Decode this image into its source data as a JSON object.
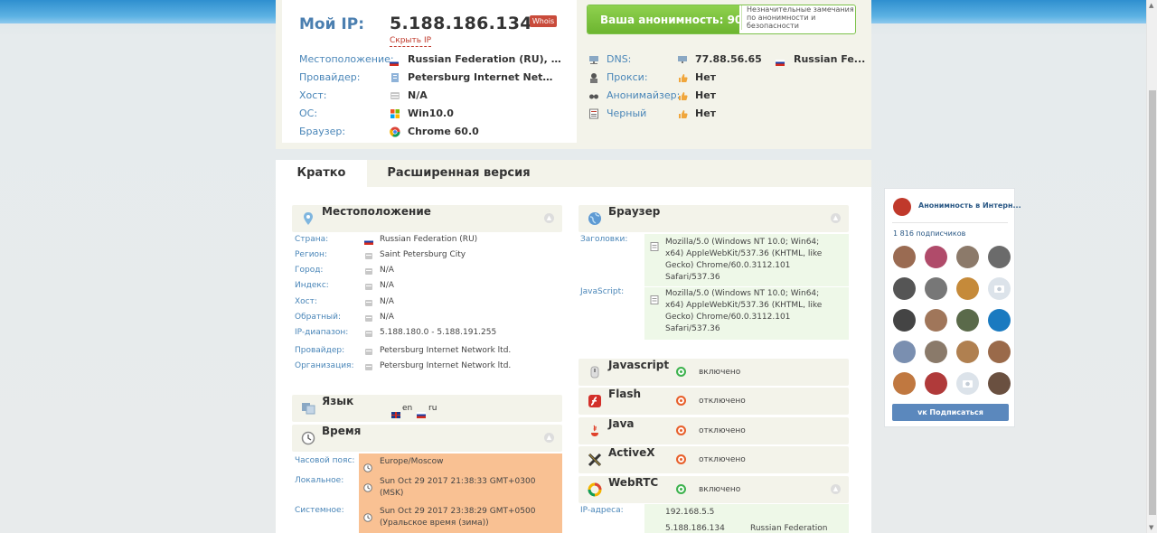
{
  "summary": {
    "ip_label": "Мой IP:",
    "ip_value": "5.188.186.134",
    "whois_label": "Whois",
    "hide_ip_label": "Скрыть IP",
    "rows": [
      {
        "label": "Местоположение:",
        "value": "Russian Federation (RU), N...",
        "icon": "flag-ru-icon"
      },
      {
        "label": "Провайдер:",
        "value": "Petersburg Internet Netwo...",
        "icon": "provider-icon"
      },
      {
        "label": "Хост:",
        "value": "N/A",
        "icon": "host-icon"
      },
      {
        "label": "ОС:",
        "value": "Win10.0",
        "icon": "windows-icon"
      },
      {
        "label": "Браузер:",
        "value": "Chrome 60.0",
        "icon": "chrome-icon"
      }
    ],
    "anonymity": {
      "label": "Ваша анонимность: 90%",
      "percent": 90,
      "note": "Незначительные замечания по анонимности и безопасности"
    },
    "right_rows": [
      {
        "label": "DNS:",
        "value": "77.88.56.65",
        "extra": "Russian Fe..."
      },
      {
        "label": "Прокси:",
        "value": "Нет"
      },
      {
        "label": "Анонимайзер:",
        "value": "Нет"
      },
      {
        "label": "Черный",
        "value": "Нет"
      }
    ]
  },
  "tabs": [
    "Кратко",
    "Расширенная версия"
  ],
  "location": {
    "title": "Местоположение",
    "rows": [
      {
        "label": "Страна:",
        "value": "Russian Federation (RU)"
      },
      {
        "label": "Регион:",
        "value": "Saint Petersburg City"
      },
      {
        "label": "Город:",
        "value": "N/A"
      },
      {
        "label": "Индекс:",
        "value": "N/A"
      },
      {
        "label": "Хост:",
        "value": "N/A"
      },
      {
        "label": "Обратный:",
        "value": "N/A"
      },
      {
        "label": "IP-диапазон:",
        "value": "5.188.180.0 - 5.188.191.255"
      },
      {
        "label": "Провайдер:",
        "value": "Petersburg Internet Network ltd."
      },
      {
        "label": "Организация:",
        "value": "Petersburg Internet Network ltd."
      }
    ]
  },
  "language": {
    "title": "Язык",
    "en": "en",
    "ru": "ru"
  },
  "time": {
    "title": "Время",
    "rows": [
      {
        "label": "Часовой пояс:",
        "lines": [
          "Europe/Moscow"
        ]
      },
      {
        "label": "Локальное:",
        "lines": [
          "Sun Oct 29 2017 21:38:33 GMT+0300",
          "(MSK)"
        ]
      },
      {
        "label": "Системное:",
        "lines": [
          "Sun Oct 29 2017 23:38:29 GMT+0500",
          "(Уральское время (зима))"
        ]
      }
    ]
  },
  "browser": {
    "title": "Браузер",
    "headers_label": "Заголовки:",
    "headers_lines": [
      "Mozilla/5.0 (Windows NT 10.0; Win64;",
      "x64) AppleWebKit/537.36 (KHTML, like",
      "Gecko) Chrome/60.0.3112.101",
      "Safari/537.36"
    ],
    "js_label": "JavaScript:",
    "js_lines": [
      "Mozilla/5.0 (Windows NT 10.0; Win64;",
      "x64) AppleWebKit/537.36 (KHTML, like",
      "Gecko) Chrome/60.0.3112.101",
      "Safari/537.36"
    ]
  },
  "plugins": [
    {
      "name": "Javascript",
      "status": "включено",
      "on": true
    },
    {
      "name": "Flash",
      "status": "отключено",
      "on": false
    },
    {
      "name": "Java",
      "status": "отключено",
      "on": false
    },
    {
      "name": "ActiveX",
      "status": "отключено",
      "on": false
    },
    {
      "name": "WebRTC",
      "status": "включено",
      "on": true
    }
  ],
  "webrtc": {
    "label": "IP-адреса:",
    "ip1": "192.168.5.5",
    "ip2": "5.188.186.134",
    "ip2_country": "Russian Federation"
  },
  "vk": {
    "name": "Анонимность в Интерн...",
    "subscribers": "1 816 подписчиков",
    "button": "Подписаться"
  },
  "colors": {
    "accent": "#4a86b8",
    "anon_bar": "#7cc24a",
    "orange": "#f9c193",
    "green_bg": "#eef8e8",
    "vk_button": "#5b88bd"
  }
}
